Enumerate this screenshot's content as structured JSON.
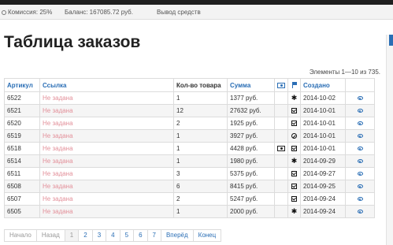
{
  "topbar": {
    "commission": "Комиссия: 25%",
    "balance": "Баланс: 167085.72 руб.",
    "withdraw": "Вывод средств"
  },
  "page": {
    "title": "Таблица заказов",
    "count": "Элементы 1—10 из 735."
  },
  "table": {
    "headers": {
      "article": "Артикул",
      "link": "Ссылка",
      "qty": "Кол-во товара",
      "sum": "Сумма",
      "created": "Создано"
    },
    "rows": [
      {
        "article": "6522",
        "link": "Не задана",
        "qty": "1",
        "sum": "1377 руб.",
        "pay": "",
        "status": "asterisk",
        "created": "2014-10-02"
      },
      {
        "article": "6521",
        "link": "Не задана",
        "qty": "12",
        "sum": "27632 руб.",
        "pay": "",
        "status": "check",
        "created": "2014-10-01"
      },
      {
        "article": "6520",
        "link": "Не задана",
        "qty": "2",
        "sum": "1925 руб.",
        "pay": "",
        "status": "check",
        "created": "2014-10-01"
      },
      {
        "article": "6519",
        "link": "Не задана",
        "qty": "1",
        "sum": "3927 руб.",
        "pay": "",
        "status": "ban",
        "created": "2014-10-01"
      },
      {
        "article": "6518",
        "link": "Не задана",
        "qty": "1",
        "sum": "4428 руб.",
        "pay": "money",
        "status": "check",
        "created": "2014-10-01"
      },
      {
        "article": "6514",
        "link": "Не задана",
        "qty": "1",
        "sum": "1980 руб.",
        "pay": "",
        "status": "asterisk",
        "created": "2014-09-29"
      },
      {
        "article": "6511",
        "link": "Не задана",
        "qty": "3",
        "sum": "5375 руб.",
        "pay": "",
        "status": "check",
        "created": "2014-09-27"
      },
      {
        "article": "6508",
        "link": "Не задана",
        "qty": "6",
        "sum": "8415 руб.",
        "pay": "",
        "status": "check",
        "created": "2014-09-25"
      },
      {
        "article": "6507",
        "link": "Не задана",
        "qty": "2",
        "sum": "5247 руб.",
        "pay": "",
        "status": "check",
        "created": "2014-09-24"
      },
      {
        "article": "6505",
        "link": "Не задана",
        "qty": "1",
        "sum": "2000 руб.",
        "pay": "",
        "status": "asterisk",
        "created": "2014-09-24"
      }
    ]
  },
  "pager": {
    "first": "Начало",
    "prev": "Назад",
    "pages": [
      "1",
      "2",
      "3",
      "4",
      "5",
      "6",
      "7"
    ],
    "next": "Вперёд",
    "last": "Конец"
  }
}
